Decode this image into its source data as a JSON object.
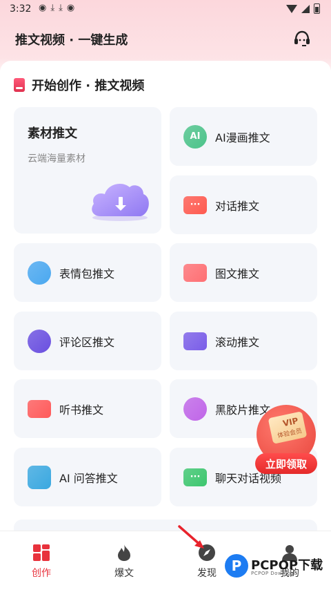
{
  "status_bar": {
    "time": "3:32",
    "notification_icons": [
      "wechat-icon",
      "download-icon",
      "download-icon",
      "wechat-icon"
    ]
  },
  "app_bar": {
    "title": "推文视频 · 一键生成",
    "service_icon": "customer-service-icon"
  },
  "section": {
    "title": "开始创作 · 推文视频"
  },
  "featured_card": {
    "title": "素材推文",
    "subtitle": "云端海量素材"
  },
  "cards": [
    {
      "label": "AI漫画推文",
      "icon": "ai-comic-icon",
      "icon_text": "AI",
      "color": "#4cc38a"
    },
    {
      "label": "对话推文",
      "icon": "dialogue-icon",
      "icon_text": "···",
      "color": "#ff5a4f"
    },
    {
      "label": "表情包推文",
      "icon": "emoji-icon",
      "icon_text": "",
      "color": "#4aa8f0"
    },
    {
      "label": "图文推文",
      "icon": "image-text-icon",
      "icon_text": "",
      "color": "#ff6f73"
    },
    {
      "label": "评论区推文",
      "icon": "comment-icon",
      "icon_text": "",
      "color": "#6a4fe0"
    },
    {
      "label": "滚动推文",
      "icon": "scroll-play-icon",
      "icon_text": "",
      "color": "#7a5de8"
    },
    {
      "label": "听书推文",
      "icon": "book-icon",
      "icon_text": "",
      "color": "#ff5a5a"
    },
    {
      "label": "黑胶片推文",
      "icon": "vinyl-icon",
      "icon_text": "",
      "color": "#c065e8"
    },
    {
      "label": "AI 问答推文",
      "icon": "ai-qa-icon",
      "icon_text": "",
      "color": "#3aa8e0"
    },
    {
      "label": "聊天对话视频",
      "icon": "chat-video-icon",
      "icon_text": "···",
      "color": "#3cc66e"
    }
  ],
  "vip_badge": {
    "tag": "VIP",
    "subtitle": "体验会员",
    "button": "立即领取"
  },
  "tabs": [
    {
      "label": "创作",
      "icon": "grid-icon",
      "active": true
    },
    {
      "label": "爆文",
      "icon": "flame-icon",
      "active": false
    },
    {
      "label": "发现",
      "icon": "compass-icon",
      "active": false
    },
    {
      "label": "我的",
      "icon": "user-icon",
      "active": false
    }
  ],
  "watermark": {
    "brand": "PCPOP下载",
    "small": "PCPOP Download"
  },
  "colors": {
    "accent": "#e8323c",
    "header_bg": "#fcd7dc",
    "card_bg": "#f4f6fa"
  }
}
